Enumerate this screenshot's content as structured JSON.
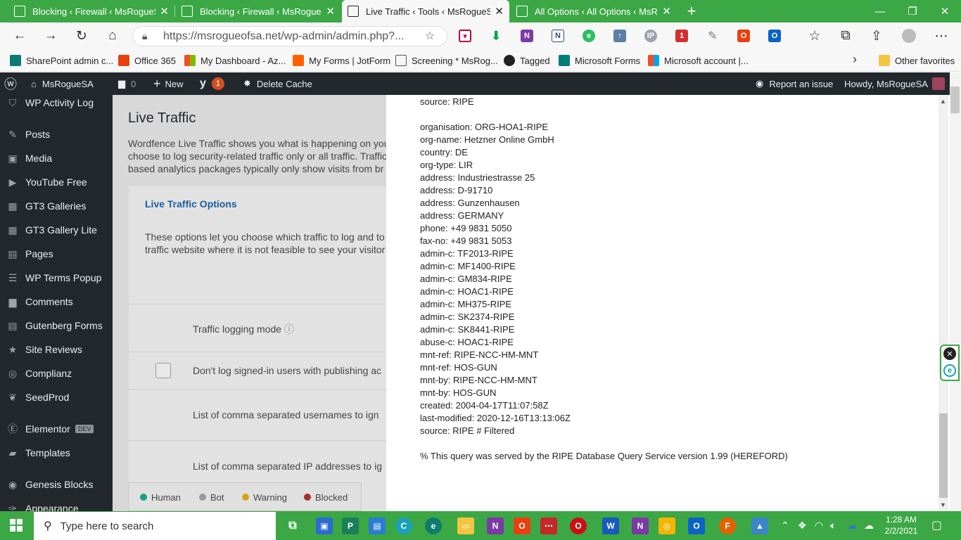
{
  "browser": {
    "tabs": [
      {
        "title": "Blocking ‹ Firewall ‹ MsRogueSA",
        "active": false
      },
      {
        "title": "Blocking ‹ Firewall ‹ MsRogueSA",
        "active": false
      },
      {
        "title": "Live Traffic ‹ Tools ‹ MsRogueSA",
        "active": true
      },
      {
        "title": "All Options ‹ All Options ‹ MsRogueSA",
        "active": false
      }
    ],
    "url": "https://msrogueofsa.net/wp-admin/admin.php?...",
    "favorites": [
      "SharePoint admin c...",
      "Office 365",
      "My Dashboard - Az...",
      "My Forms | JotForm",
      "Screening * MsRog...",
      "Tagged",
      "Microsoft Forms",
      "Microsoft account |...",
      "Other favorites"
    ]
  },
  "wp_bar": {
    "site": "MsRogueSA",
    "comments_count": "0",
    "new_label": "New",
    "yoast_badge": "1",
    "delete_cache": "Delete Cache",
    "report_issue": "Report an issue",
    "howdy": "Howdy, MsRogueSA"
  },
  "sidebar": {
    "items": [
      {
        "label": "WP Activity Log",
        "icon": "shield-icon"
      },
      {
        "label": "Posts",
        "icon": "pin-icon"
      },
      {
        "label": "Media",
        "icon": "media-icon"
      },
      {
        "label": "YouTube Free",
        "icon": "youtube-icon"
      },
      {
        "label": "GT3 Galleries",
        "icon": "gallery-icon"
      },
      {
        "label": "GT3 Gallery Lite",
        "icon": "gallery-icon"
      },
      {
        "label": "Pages",
        "icon": "page-icon"
      },
      {
        "label": "WP Terms Popup",
        "icon": "list-icon"
      },
      {
        "label": "Comments",
        "icon": "comment-icon"
      },
      {
        "label": "Gutenberg Forms",
        "icon": "form-icon"
      },
      {
        "label": "Site Reviews",
        "icon": "star-icon"
      },
      {
        "label": "Complianz",
        "icon": "compliance-icon"
      },
      {
        "label": "SeedProd",
        "icon": "seedprod-icon"
      },
      {
        "label": "Elementor",
        "icon": "elementor-icon",
        "badge": "DEV"
      },
      {
        "label": "Templates",
        "icon": "folder-icon"
      },
      {
        "label": "Genesis Blocks",
        "icon": "genesis-icon"
      },
      {
        "label": "Appearance",
        "icon": "brush-icon"
      }
    ]
  },
  "page": {
    "title": "Live Traffic",
    "intro_lines": [
      "Wordfence Live Traffic shows you what is happening on you",
      "choose to log security-related traffic only or all traffic. Traffic",
      "based analytics packages typically only show visits from br"
    ],
    "options_link": "Live Traffic Options",
    "options_desc": [
      "These options let you choose which traffic to log and to",
      "traffic website where it is not feasible to see your visitor"
    ],
    "settings": [
      "Traffic logging mode",
      "Don't log signed-in users with publishing ac",
      "List of comma separated usernames to ign",
      "List of comma separated IP addresses to ig"
    ],
    "legend": [
      "Human",
      "Bot",
      "Warning",
      "Blocked"
    ]
  },
  "whois_lines": [
    "source: RIPE",
    "",
    "organisation: ORG-HOA1-RIPE",
    "org-name: Hetzner Online GmbH",
    "country: DE",
    "org-type: LIR",
    "address: Industriestrasse 25",
    "address: D-91710",
    "address: Gunzenhausen",
    "address: GERMANY",
    "phone: +49 9831 5050",
    "fax-no: +49 9831 5053",
    "admin-c: TF2013-RIPE",
    "admin-c: MF1400-RIPE",
    "admin-c: GM834-RIPE",
    "admin-c: HOAC1-RIPE",
    "admin-c: MH375-RIPE",
    "admin-c: SK2374-RIPE",
    "admin-c: SK8441-RIPE",
    "abuse-c: HOAC1-RIPE",
    "mnt-ref: RIPE-NCC-HM-MNT",
    "mnt-ref: HOS-GUN",
    "mnt-by: RIPE-NCC-HM-MNT",
    "mnt-by: HOS-GUN",
    "created: 2004-04-17T11:07:58Z",
    "last-modified: 2020-12-16T13:13:06Z",
    "source: RIPE # Filtered",
    "",
    "% This query was served by the RIPE Database Query Service version 1.99 (HEREFORD)"
  ],
  "taskbar": {
    "search_placeholder": "Type here to search",
    "time": "1:28 AM",
    "date": "2/2/2021"
  },
  "colors": {
    "accent": "#3ba845",
    "wp_dark": "#23282d",
    "link": "#2271b1"
  }
}
